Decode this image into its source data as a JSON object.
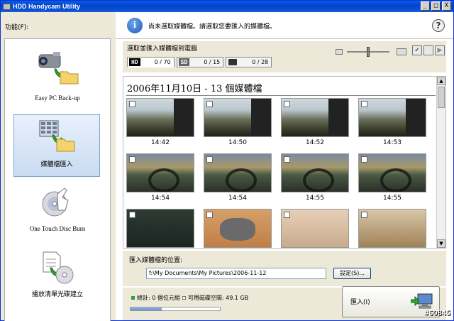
{
  "window": {
    "title": "HDD Handycam Utility",
    "minimize": "_",
    "maximize": "□",
    "close": "X"
  },
  "sidebar": {
    "label": "功能(F):",
    "items": [
      {
        "label": "Easy PC Back-up",
        "icon": "camera-to-folder-icon"
      },
      {
        "label": "媒體檔匯入",
        "icon": "files-to-folder-icon",
        "selected": true
      },
      {
        "label": "One Touch Disc Burn",
        "icon": "disc-touch-icon"
      },
      {
        "label": "播放清單光碟建立",
        "icon": "document-to-disc-icon"
      }
    ]
  },
  "info": {
    "text": "尚未選取媒體檔。請選取您要匯入的媒體檔。",
    "help": "?"
  },
  "toolbar": {
    "title": "選取並匯入媒體檔到電腦",
    "tabs": [
      {
        "badge": "HD",
        "count": "0 / 70",
        "active": true
      },
      {
        "badge": "SD",
        "count": "0 / 15",
        "active": false
      },
      {
        "badge": "",
        "count": "0 / 28",
        "active": false
      }
    ]
  },
  "gallery": {
    "date_header": "2006年11月10日 - 13 個媒體檔",
    "thumbnails": [
      {
        "time": "14:42",
        "scene": "city"
      },
      {
        "time": "14:50",
        "scene": "city"
      },
      {
        "time": "14:52",
        "scene": "city"
      },
      {
        "time": "14:53",
        "scene": "city"
      },
      {
        "time": "14:54",
        "scene": "kids"
      },
      {
        "time": "14:54",
        "scene": "kids"
      },
      {
        "time": "14:55",
        "scene": "kids"
      },
      {
        "time": "14:55",
        "scene": "kids"
      },
      {
        "time": "",
        "scene": "dark"
      },
      {
        "time": "",
        "scene": "mouse"
      },
      {
        "time": "",
        "scene": "hand"
      },
      {
        "time": "",
        "scene": "room"
      }
    ]
  },
  "import_location": {
    "label": "匯入媒體檔的位置:",
    "path": "f:\\My Documents\\My Pictures\\2006-11-12",
    "settings_button": "設定(S)..."
  },
  "status": {
    "total": "總計: 0 個位元組",
    "free_space": "可用磁碟空間: 49.1 GB",
    "progress": 0.35
  },
  "import_button": {
    "label": "匯入(I)"
  },
  "watermark": "#60845",
  "colors": {
    "title_bar": "#0244c9",
    "selected_item": "#c9dcf3"
  }
}
